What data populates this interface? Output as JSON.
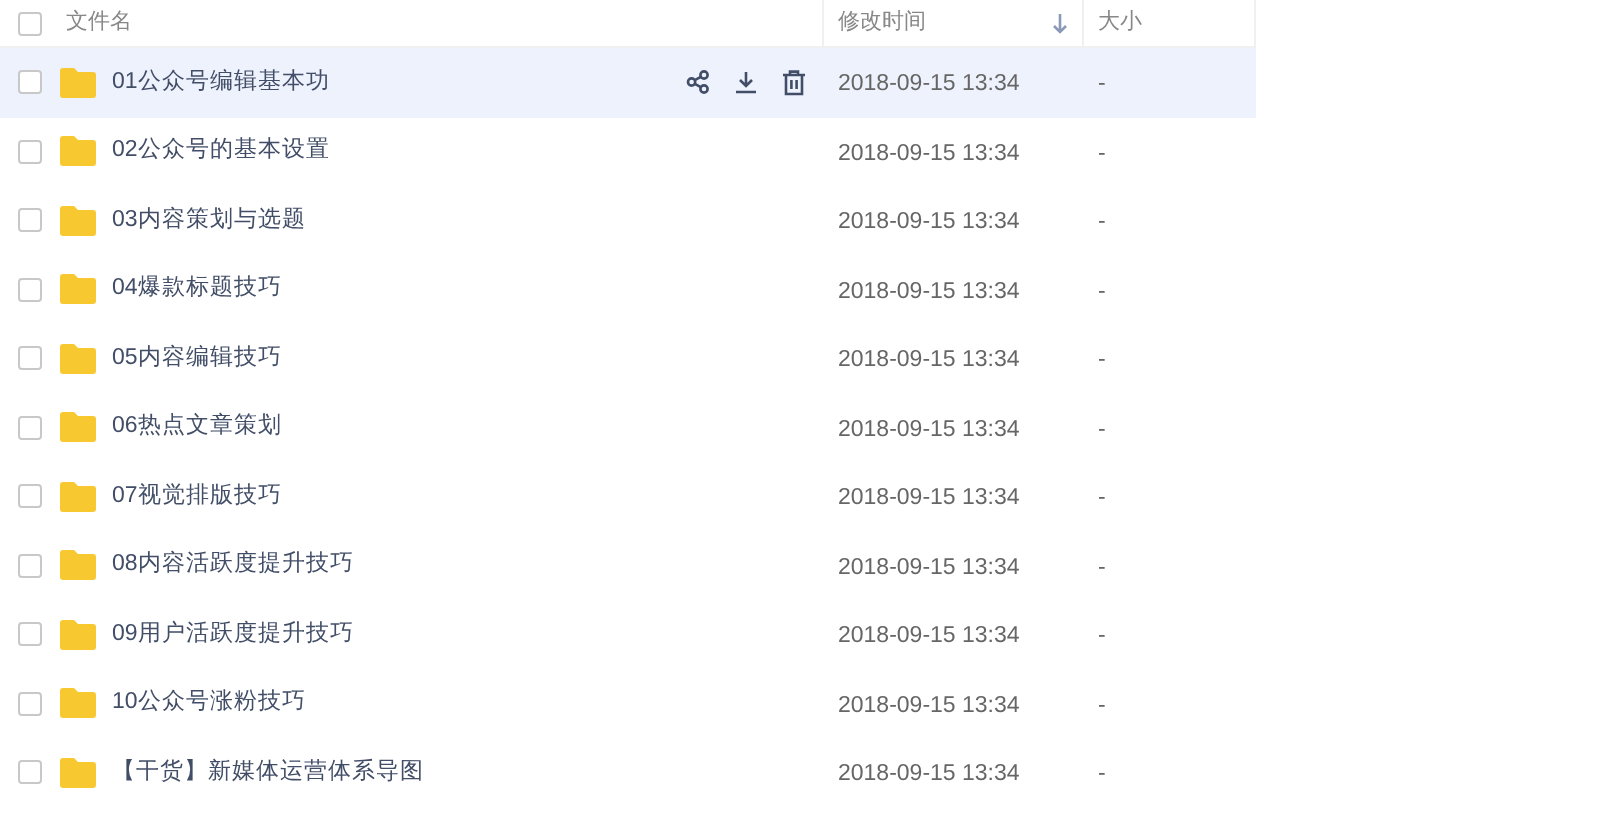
{
  "header": {
    "checked": false,
    "columns": [
      {
        "label": "文件名",
        "sorted_descending": false
      },
      {
        "label": "修改时间",
        "sorted_descending": true
      },
      {
        "label": "大小",
        "sorted_descending": false
      }
    ]
  },
  "rows": [
    {
      "name": "01公众号编辑基本功",
      "modified": "2018-09-15 13:34",
      "size": "-",
      "checked": false,
      "hovered": true
    },
    {
      "name": "02公众号的基本设置",
      "modified": "2018-09-15 13:34",
      "size": "-",
      "checked": false,
      "hovered": false
    },
    {
      "name": "03内容策划与选题",
      "modified": "2018-09-15 13:34",
      "size": "-",
      "checked": false,
      "hovered": false
    },
    {
      "name": "04爆款标题技巧",
      "modified": "2018-09-15 13:34",
      "size": "-",
      "checked": false,
      "hovered": false
    },
    {
      "name": "05内容编辑技巧",
      "modified": "2018-09-15 13:34",
      "size": "-",
      "checked": false,
      "hovered": false
    },
    {
      "name": "06热点文章策划",
      "modified": "2018-09-15 13:34",
      "size": "-",
      "checked": false,
      "hovered": false
    },
    {
      "name": "07视觉排版技巧",
      "modified": "2018-09-15 13:34",
      "size": "-",
      "checked": false,
      "hovered": false
    },
    {
      "name": "08内容活跃度提升技巧",
      "modified": "2018-09-15 13:34",
      "size": "-",
      "checked": false,
      "hovered": false
    },
    {
      "name": "09用户活跃度提升技巧",
      "modified": "2018-09-15 13:34",
      "size": "-",
      "checked": false,
      "hovered": false
    },
    {
      "name": "10公众号涨粉技巧",
      "modified": "2018-09-15 13:34",
      "size": "-",
      "checked": false,
      "hovered": false
    },
    {
      "name": "【干货】新媒体运营体系导图",
      "modified": "2018-09-15 13:34",
      "size": "-",
      "checked": false,
      "hovered": false
    }
  ]
}
